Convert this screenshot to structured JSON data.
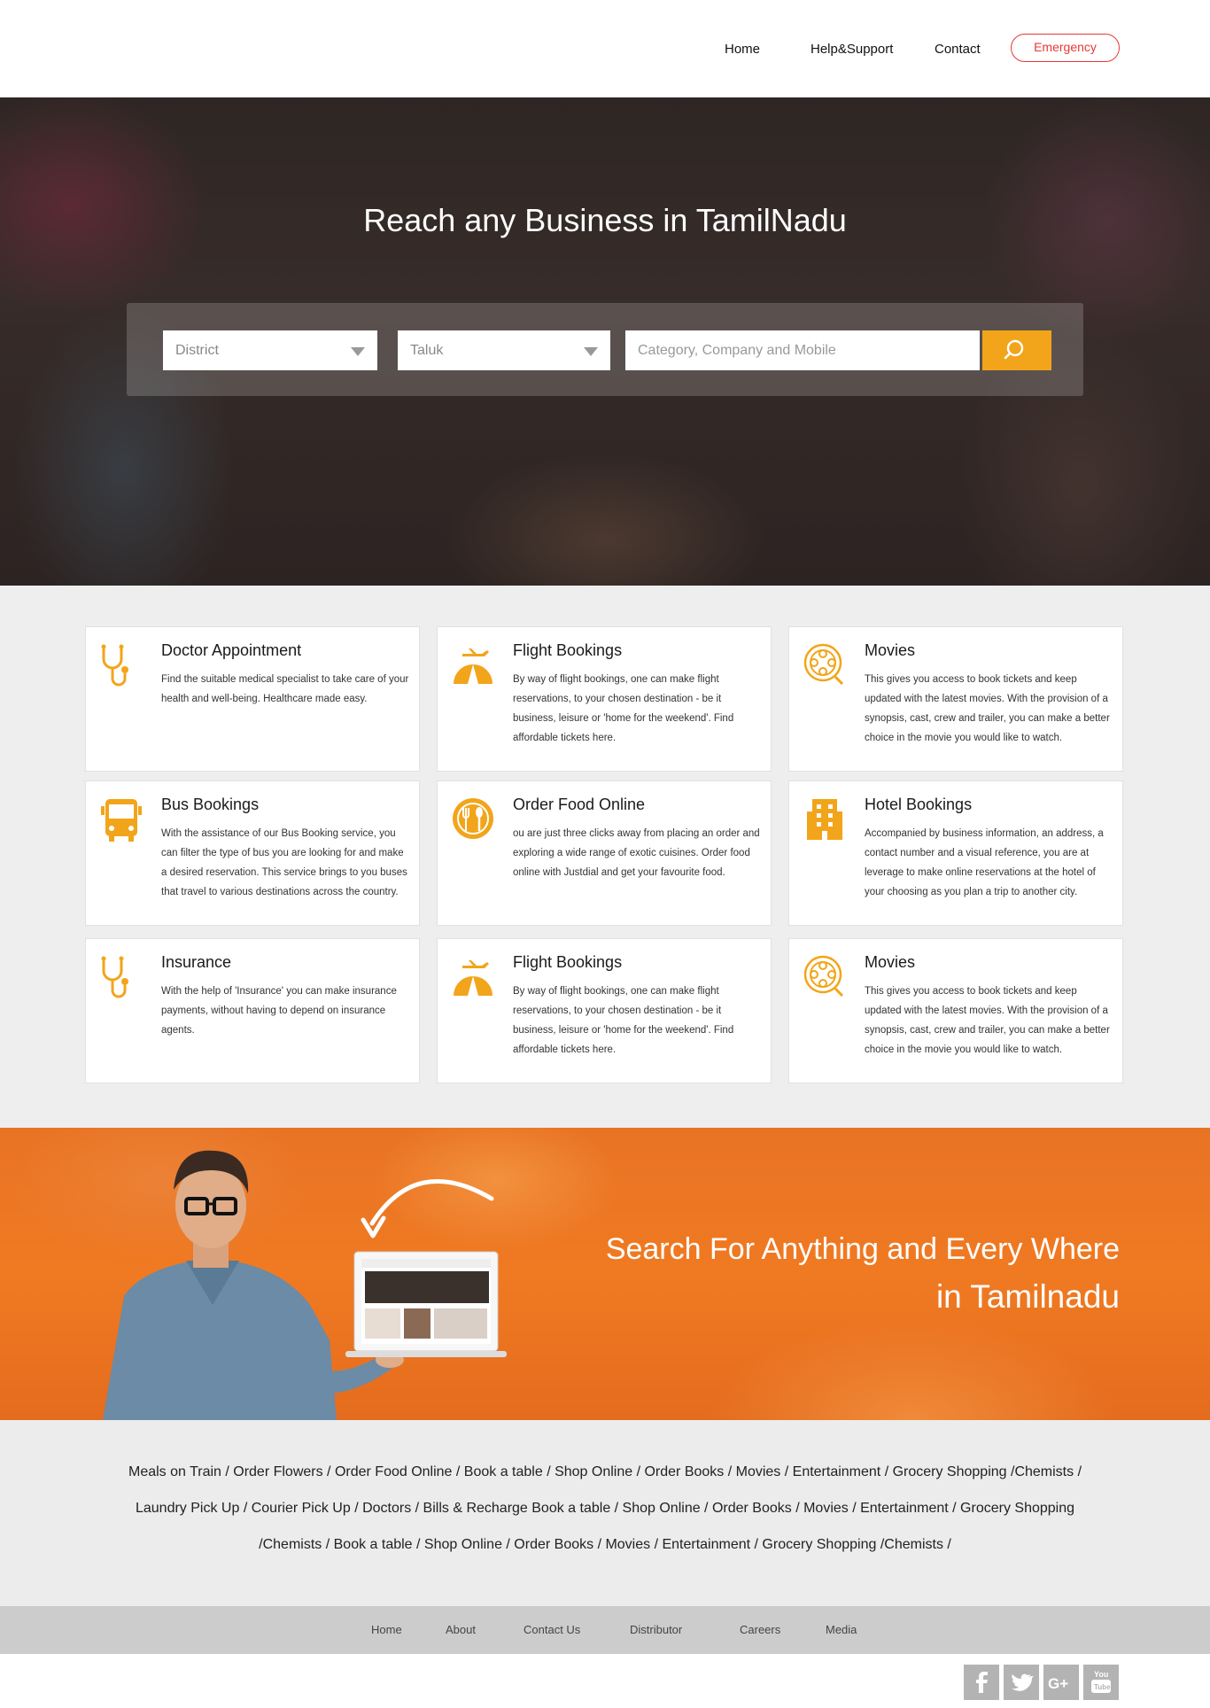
{
  "nav": {
    "home": "Home",
    "help": "Help&Support",
    "contact": "Contact",
    "emergency": "Emergency"
  },
  "hero": {
    "title": "Reach any Business in TamilNadu",
    "district_label": "District",
    "taluk_label": "Taluk",
    "search_placeholder": "Category, Company and Mobile"
  },
  "services": [
    {
      "title": "Doctor Appointment",
      "desc": "Find the suitable medical specialist to take care of your health and well-being. Healthcare made easy.",
      "icon": "stethoscope-icon"
    },
    {
      "title": "Flight Bookings",
      "desc": "By way of flight bookings, one can make flight reservations, to your chosen destination - be it business, leisure or 'home for the weekend'. Find affordable tickets here.",
      "icon": "flight-icon"
    },
    {
      "title": "Movies",
      "desc": "This gives you access to book tickets and keep updated with the latest movies. With the provision of a synopsis, cast, crew and trailer, you can make a better choice in the movie you would like to watch.",
      "icon": "film-reel-icon"
    },
    {
      "title": "Bus Bookings",
      "desc": "With the assistance of our Bus Booking service, you can filter the type of bus you are looking for and make a desired reservation. This service brings to you buses that travel to various destinations across the country.",
      "icon": "bus-icon"
    },
    {
      "title": "Order Food Online",
      "desc": "ou are just three clicks away from placing an order and exploring a wide range of exotic cuisines. Order food online with Justdial and get your favourite food.",
      "icon": "food-icon"
    },
    {
      "title": "Hotel Bookings",
      "desc": "Accompanied by business information, an address, a contact number and a visual reference, you are at leverage to make online reservations at the hotel of your choosing as you plan a trip to another city.",
      "icon": "hotel-icon"
    },
    {
      "title": "Insurance",
      "desc": "With the help of 'Insurance' you can make insurance payments, without having to depend on insurance agents.",
      "icon": "stethoscope-icon"
    },
    {
      "title": "Flight Bookings",
      "desc": "By way of flight bookings, one can make flight reservations, to your chosen destination - be it business, leisure or 'home for the weekend'. Find affordable tickets here.",
      "icon": "flight-icon"
    },
    {
      "title": "Movies",
      "desc": "This gives you access to book tickets and keep updated with the latest movies. With the provision of a synopsis, cast, crew and trailer, you can make a better choice in the movie you would like to watch.",
      "icon": "film-reel-icon"
    }
  ],
  "promo": {
    "line1": "Search For Anything and Every Where",
    "line2": "in Tamilnadu"
  },
  "links": {
    "line1": "Meals on Train / Order Flowers / Order Food Online / Book a table  / Shop Online / Order Books / Movies / Entertainment / Grocery Shopping /Chemists /",
    "line2": "Laundry Pick Up / Courier Pick Up / Doctors / Bills & Recharge Book a table  / Shop Online / Order Books / Movies / Entertainment / Grocery Shopping",
    "line3": "/Chemists / Book a table  / Shop Online / Order Books / Movies / Entertainment / Grocery Shopping /Chemists /"
  },
  "footer": {
    "home": "Home",
    "about": "About",
    "contact": "Contact Us",
    "distributor": "Distributor",
    "careers": "Careers",
    "media": "Media"
  },
  "social": [
    "facebook-icon",
    "twitter-icon",
    "google-plus-icon",
    "youtube-icon"
  ],
  "colors": {
    "accent": "#f2a51a",
    "promo": "#f07a22",
    "emergency": "#e53935"
  }
}
